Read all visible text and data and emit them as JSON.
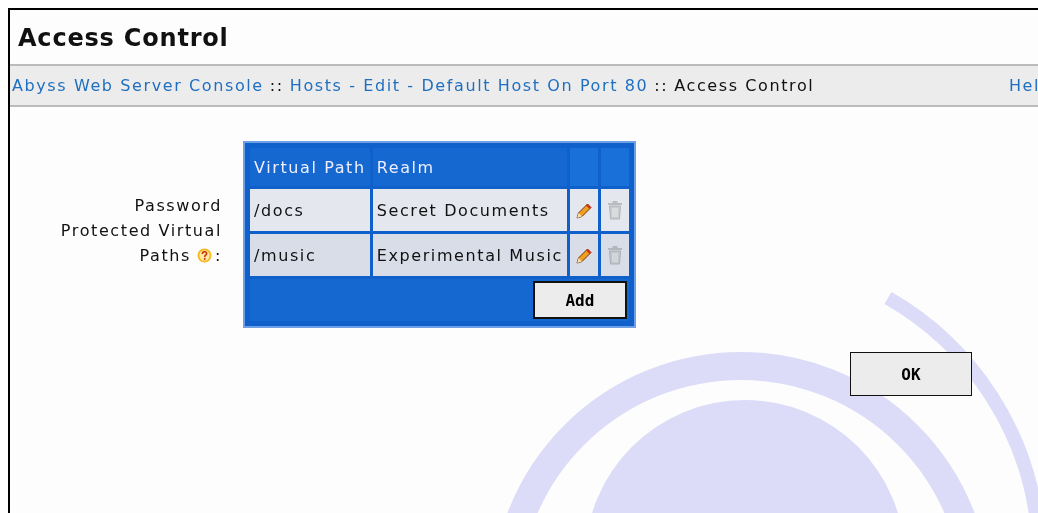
{
  "page": {
    "title": "Access Control"
  },
  "breadcrumb": {
    "items": [
      {
        "label": "Abyss Web Server Console",
        "link": true
      },
      {
        "label": "Hosts - Edit - Default Host On Port 80",
        "link": true
      },
      {
        "label": "Access Control",
        "link": false
      }
    ],
    "separators": [
      "::",
      "::"
    ],
    "help": "Hel"
  },
  "field": {
    "label_lines": [
      "Password",
      "Protected Virtual",
      "Paths"
    ],
    "label_suffix": ":"
  },
  "table": {
    "columns": [
      "Virtual Path",
      "Realm"
    ],
    "rows": [
      {
        "path": "/docs",
        "realm": "Secret Documents",
        "delete_disabled": true
      },
      {
        "path": "/music",
        "realm": "Experimental Music",
        "delete_disabled": true
      }
    ],
    "add_button": "Add"
  },
  "buttons": [
    "OK"
  ]
}
